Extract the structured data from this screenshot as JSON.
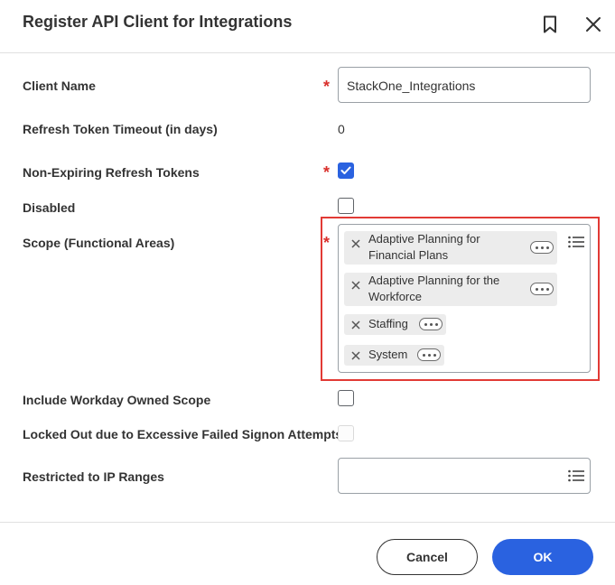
{
  "dialog": {
    "title": "Register API Client for Integrations"
  },
  "form": {
    "client_name": {
      "label": "Client Name",
      "value": "StackOne_Integrations"
    },
    "refresh_timeout": {
      "label": "Refresh Token Timeout (in days)",
      "value": "0"
    },
    "non_expiring": {
      "label": "Non-Expiring Refresh Tokens",
      "checked": true
    },
    "disabled": {
      "label": "Disabled",
      "checked": false
    },
    "scope": {
      "label": "Scope (Functional Areas)",
      "items": [
        {
          "line1": "Adaptive Planning for",
          "line2": "Financial Plans"
        },
        {
          "line1": "Adaptive Planning for the",
          "line2": "Workforce"
        },
        {
          "line1": "Staffing",
          "line2": ""
        },
        {
          "line1": "System",
          "line2": ""
        }
      ]
    },
    "include_workday": {
      "label": "Include Workday Owned Scope",
      "checked": false
    },
    "locked_out": {
      "label": "Locked Out due to Excessive Failed Signon Attempts",
      "checked": false
    },
    "ip_ranges": {
      "label": "Restricted to IP Ranges",
      "value": ""
    }
  },
  "required_marker": "*",
  "footer": {
    "cancel_label": "Cancel",
    "ok_label": "OK"
  },
  "colors": {
    "accent": "#2a62e0",
    "required": "#d9302c",
    "highlight": "#e23a35"
  }
}
